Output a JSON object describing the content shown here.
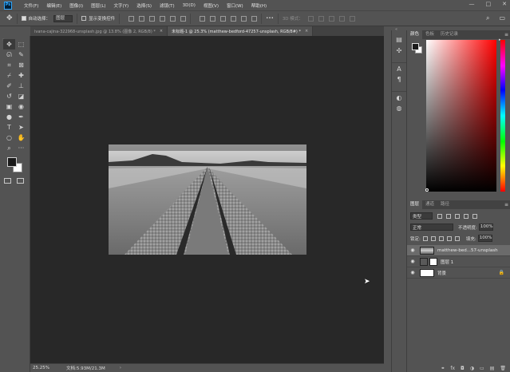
{
  "app": {
    "logo_text": "Ps"
  },
  "menu": [
    "文件(F)",
    "编辑(E)",
    "图像(I)",
    "图层(L)",
    "文字(Y)",
    "选择(S)",
    "滤镜(T)",
    "3D(D)",
    "视图(V)",
    "窗口(W)",
    "帮助(H)"
  ],
  "window_controls": {
    "minimize": "—",
    "maximize": "□",
    "close": "✕"
  },
  "options": {
    "auto_select_label": "自动选择：",
    "auto_select_value": "图层",
    "show_transform_label": "显示变换控件",
    "mode_3d_label": "3D 模式：",
    "more": "•••",
    "search": "⌕",
    "workspace": "▭"
  },
  "tabs": [
    {
      "label": "ivana-cajina-322968-unsplash.jpg @ 13.8% (图像 2, RGB/8) *",
      "close": "×"
    },
    {
      "label": "未标题-1 @ 25.3% (matthew-bedford-47257-unsplash, RGB/8#) *",
      "close": "×"
    }
  ],
  "status": {
    "zoom": "25.25%",
    "doc": "文档:5.93M/21.3M",
    "arrow": "›"
  },
  "panels": {
    "color_tabs": [
      "颜色",
      "色板",
      "历史记录"
    ],
    "layer_tabs": [
      "图层",
      "通道",
      "路径"
    ],
    "menu_glyph": "≡"
  },
  "layers_panel": {
    "filter_value": "类型",
    "blend_mode": "正常",
    "opacity_label": "不透明度:",
    "opacity_value": "100%",
    "lock_label": "锁定:",
    "fill_label": "填充:",
    "fill_value": "100%",
    "items": [
      {
        "name": "matthew-bed...57-unsplash"
      },
      {
        "name": "图层 1"
      },
      {
        "name": "背景"
      }
    ],
    "footer_icons": [
      "⚭",
      "fx",
      "◘",
      "◑",
      "▭",
      "▤",
      "🗑"
    ]
  },
  "colors": {
    "accent": "#31a8ff",
    "fg": "#1a1a1a",
    "bg": "#ffffff",
    "canvas": "#282828",
    "chrome": "#535353"
  }
}
